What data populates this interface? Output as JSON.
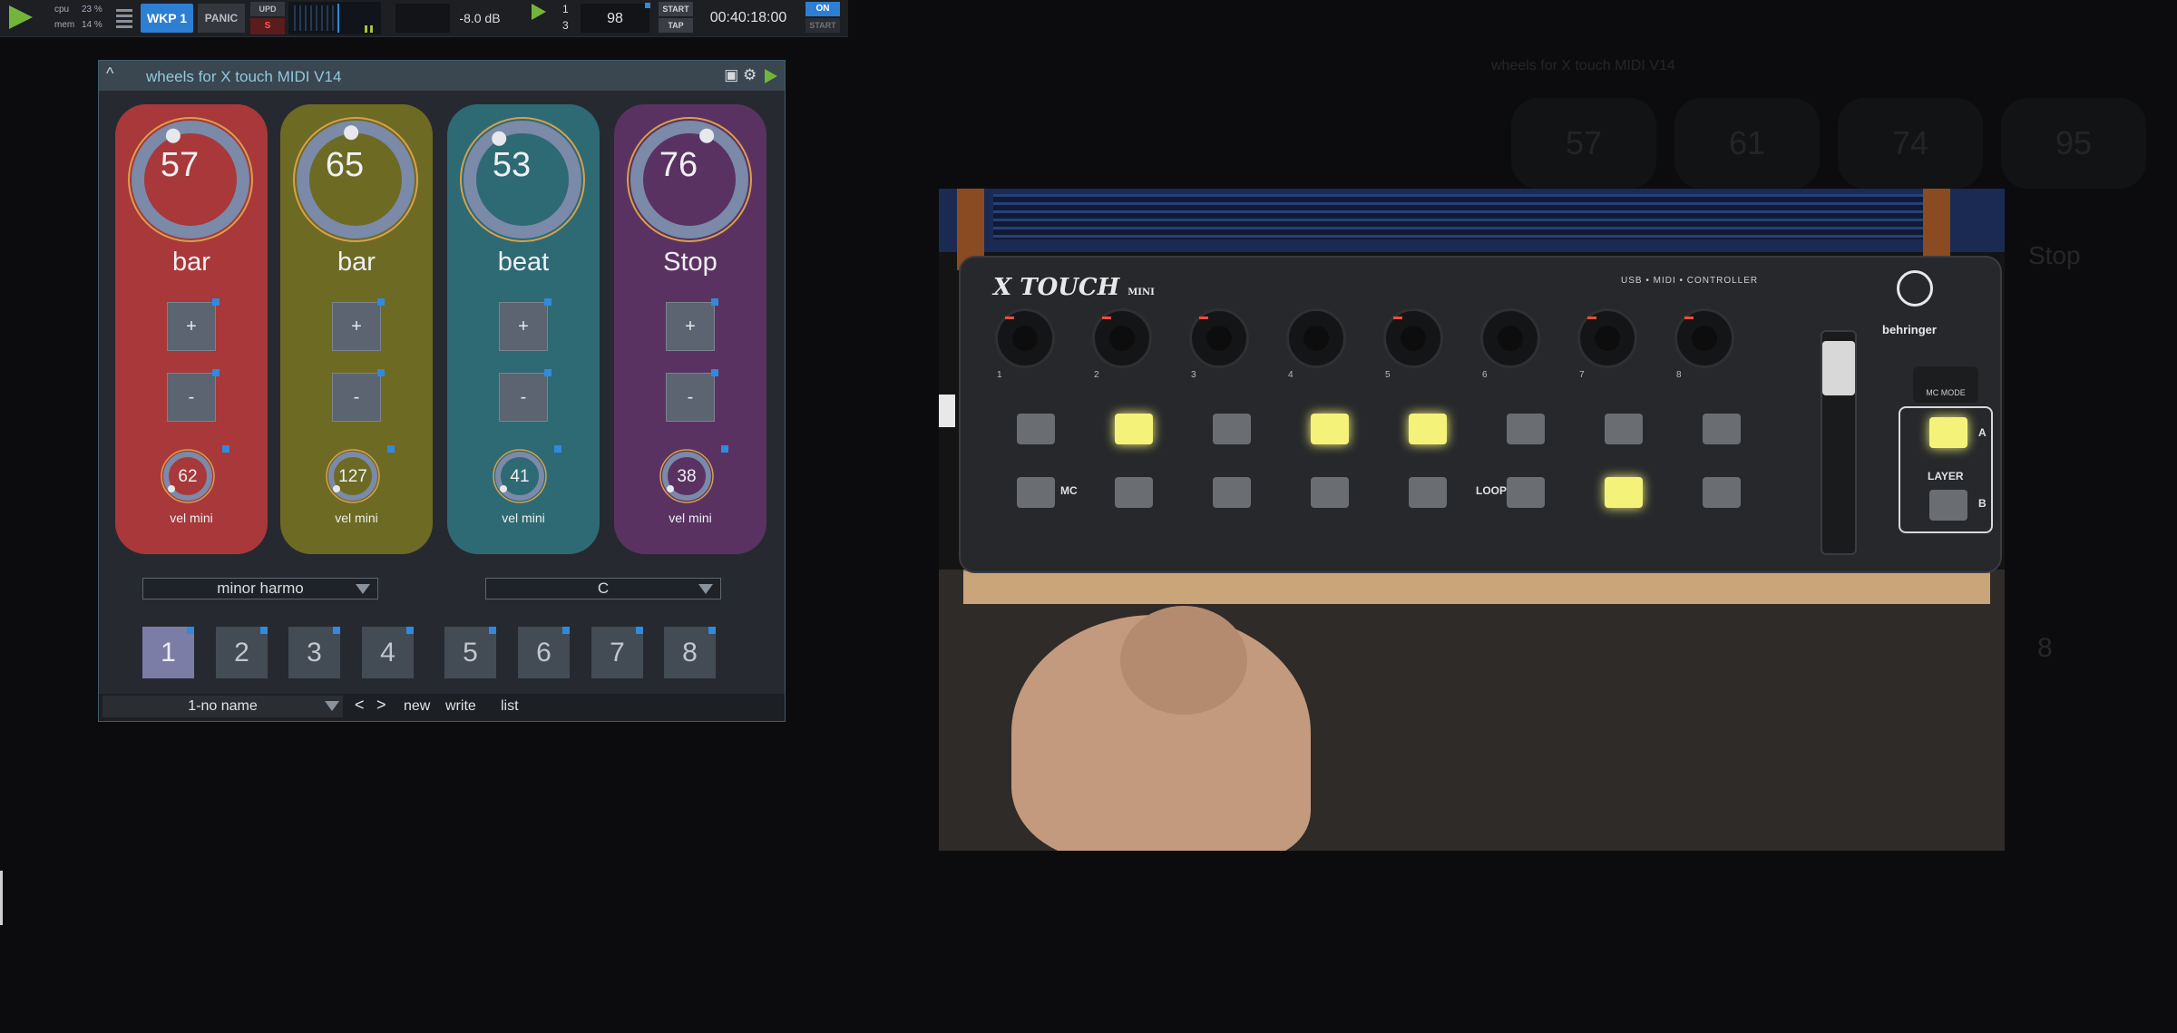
{
  "topbar": {
    "cpu_label": "cpu",
    "cpu_value": "23 %",
    "mem_label": "mem",
    "mem_value": "14 %",
    "workspace_button": "WKP 1",
    "panic_button": "PANIC",
    "upd_button": "UPD",
    "solo_button": "S",
    "volume": "-8.0 dB",
    "signature_top": "1",
    "signature_bottom": "3",
    "tempo": "98",
    "start_button": "START",
    "tap_button": "TAP",
    "clock": "00:40:18:00",
    "on_button": "ON",
    "start2_button": "START"
  },
  "panel": {
    "title": "wheels for X touch MIDI V14",
    "icons": [
      "camera-icon",
      "gear-icon",
      "play-icon"
    ],
    "strips": [
      {
        "value": "57",
        "label": "bar",
        "plus": "+",
        "minus": "-",
        "mini_value": "62",
        "mini_label": "vel mini",
        "color": "#a8383a",
        "knob_level": 0.42
      },
      {
        "value": "65",
        "label": "bar",
        "plus": "+",
        "minus": "-",
        "mini_value": "127",
        "mini_label": "vel mini",
        "color": "#6d6a24",
        "knob_level": 0.48
      },
      {
        "value": "53",
        "label": "beat",
        "plus": "+",
        "minus": "-",
        "mini_value": "41",
        "mini_label": "vel mini",
        "color": "#2e6a74",
        "knob_level": 0.39
      },
      {
        "value": "76",
        "label": "Stop",
        "plus": "+",
        "minus": "-",
        "mini_value": "38",
        "mini_label": "vel mini",
        "color": "#5a3262",
        "knob_level": 0.58
      }
    ],
    "scale_select": "minor harmo",
    "key_select": "C",
    "presets": [
      "1",
      "2",
      "3",
      "4",
      "5",
      "6",
      "7",
      "8"
    ],
    "active_preset": "1",
    "bank_select": "1-no name",
    "prev_label": "<",
    "next_label": ">",
    "new_label": "new",
    "write_label": "write",
    "list_label": "list"
  },
  "video": {
    "brand_logo": "X TOUCH",
    "brand_logo_sub": "MINI",
    "usb_text": "USB • MIDI • CONTROLLER",
    "maker": "behringer",
    "knob_numbers": [
      "1",
      "2",
      "3",
      "4",
      "5",
      "6",
      "7",
      "8"
    ],
    "labels": {
      "mc": "MC",
      "loop": "LOOP",
      "mc_mode": "MC MODE",
      "layer": "LAYER",
      "a": "A",
      "b": "B"
    }
  },
  "ghost": {
    "title": "wheels for X touch MIDI V14",
    "values": [
      "57",
      "61",
      "74",
      "95"
    ],
    "label": "Stop",
    "preset": "8"
  }
}
